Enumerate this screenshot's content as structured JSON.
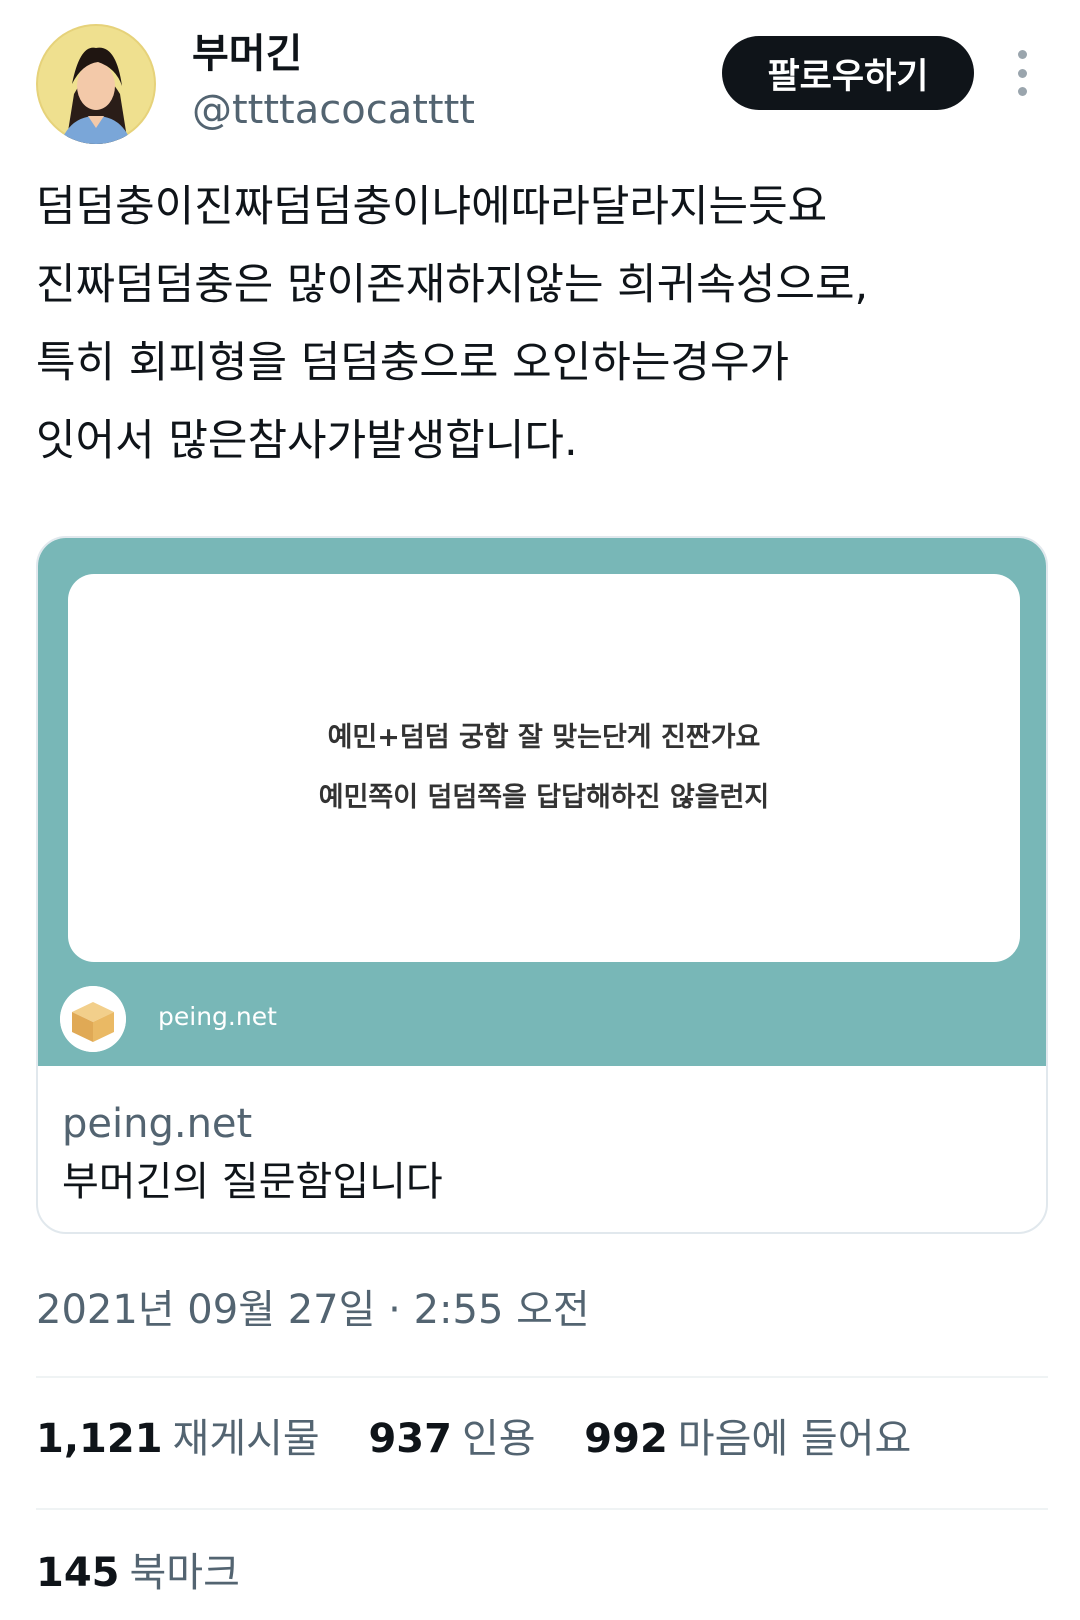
{
  "author": {
    "name": "부머긴",
    "handle": "@ttttacocatttt"
  },
  "follow_button": {
    "label": "팔로우하기"
  },
  "tweet": {
    "lines": [
      "덤덤충이진짜덤덤충이냐에따라달라지는듯요",
      "진짜덤덤충은 많이존재하지않는 희귀속성으로,",
      "특히 회피형을 덤덤충으로 오인하는경우가",
      "잇어서 많은참사가발생합니다."
    ]
  },
  "card": {
    "question_lines": [
      "예민+덤덤 궁합 잘 맞는단게 진짠가요",
      "예민쪽이 덤덤쪽을 답답해하진 않을런지"
    ],
    "source_label": "peing.net",
    "domain": "peing.net",
    "title": "부머긴의 질문함입니다",
    "media_color": "#78b7b7"
  },
  "timestamp": "2021년 09월 27일 · 2:55 오전",
  "stats": {
    "retweets": {
      "count": "1,121",
      "label": "재게시물"
    },
    "quotes": {
      "count": "937",
      "label": "인용"
    },
    "likes": {
      "count": "992",
      "label": "마음에 들어요"
    },
    "bookmarks": {
      "count": "145",
      "label": "북마크"
    }
  },
  "icons": [
    "avatar",
    "more-icon",
    "box-icon"
  ]
}
